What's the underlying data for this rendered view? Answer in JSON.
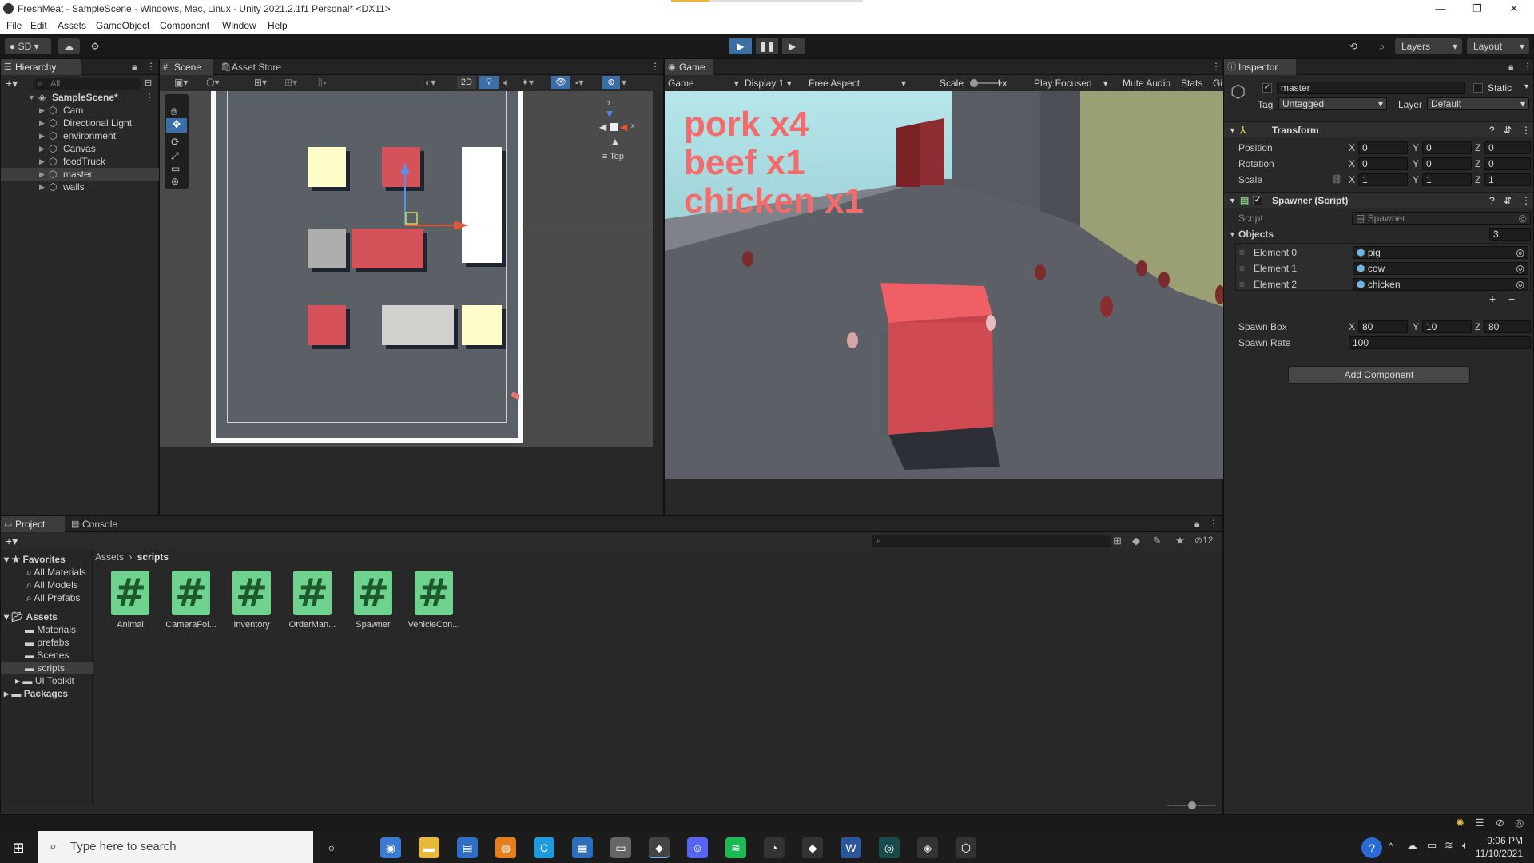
{
  "window": {
    "title": "FreshMeat - SampleScene - Windows, Mac, Linux - Unity 2021.2.1f1 Personal* <DX11>",
    "minimize": "—",
    "restore": "❐",
    "close": "✕"
  },
  "menu": [
    "File",
    "Edit",
    "Assets",
    "GameObject",
    "Component",
    "Window",
    "Help"
  ],
  "toolbar": {
    "account": "SD",
    "layers": "Layers",
    "layout": "Layout"
  },
  "hierarchy": {
    "tab": "Hierarchy",
    "search_placeholder": "All",
    "scene": "SampleScene*",
    "items": [
      "Cam",
      "Directional Light",
      "environment",
      "Canvas",
      "foodTruck",
      "master",
      "walls"
    ]
  },
  "scene": {
    "tab": "Scene",
    "asset_store_tab": "Asset Store",
    "mode_2d": "2D",
    "gizmo_label": "Top",
    "gizmo_x": "x",
    "gizmo_z": "z"
  },
  "game": {
    "tab": "Game",
    "view_select": "Game",
    "display": "Display 1",
    "aspect": "Free Aspect",
    "scale_label": "Scale",
    "scale_value": "1x",
    "play_mode": "Play Focused",
    "mute": "Mute Audio",
    "stats": "Stats",
    "gizmos": "Gi",
    "overlay_lines": [
      "pork x4",
      "beef x1",
      "chicken x1"
    ]
  },
  "inspector": {
    "tab": "Inspector",
    "object_name": "master",
    "static_label": "Static",
    "tag_label": "Tag",
    "tag_value": "Untagged",
    "layer_label": "Layer",
    "layer_value": "Default",
    "transform": {
      "title": "Transform",
      "position_label": "Position",
      "rotation_label": "Rotation",
      "scale_label": "Scale",
      "position": {
        "x": "0",
        "y": "0",
        "z": "0"
      },
      "rotation": {
        "x": "0",
        "y": "0",
        "z": "0"
      },
      "scale": {
        "x": "1",
        "y": "1",
        "z": "1"
      }
    },
    "spawner": {
      "title": "Spawner (Script)",
      "script_label": "Script",
      "script_value": "Spawner",
      "objects_label": "Objects",
      "objects_count": "3",
      "elements": [
        {
          "label": "Element 0",
          "value": "pig"
        },
        {
          "label": "Element 1",
          "value": "cow"
        },
        {
          "label": "Element 2",
          "value": "chicken"
        }
      ],
      "add": "+",
      "remove": "−",
      "spawn_box_label": "Spawn Box",
      "spawn_box": {
        "x": "80",
        "y": "10",
        "z": "80"
      },
      "spawn_rate_label": "Spawn Rate",
      "spawn_rate": "100"
    },
    "add_component": "Add Component",
    "axis_x": "X",
    "axis_y": "Y",
    "axis_z": "Z"
  },
  "project": {
    "tab": "Project",
    "console_tab": "Console",
    "hidden_count": "12",
    "favorites_label": "Favorites",
    "favorites": [
      "All Materials",
      "All Models",
      "All Prefabs"
    ],
    "assets_label": "Assets",
    "folders": [
      "Materials",
      "prefabs",
      "Scenes",
      "scripts",
      "UI Toolkit"
    ],
    "packages_label": "Packages",
    "breadcrumb_root": "Assets",
    "breadcrumb_sep": "›",
    "breadcrumb_current": "scripts",
    "files": [
      "Animal",
      "CameraFol...",
      "Inventory",
      "OrderMan...",
      "Spawner",
      "VehicleCon..."
    ],
    "script_glyph": "#"
  },
  "taskbar": {
    "search_placeholder": "Type here to search",
    "time": "9:06 PM",
    "date": "11/10/2021"
  }
}
